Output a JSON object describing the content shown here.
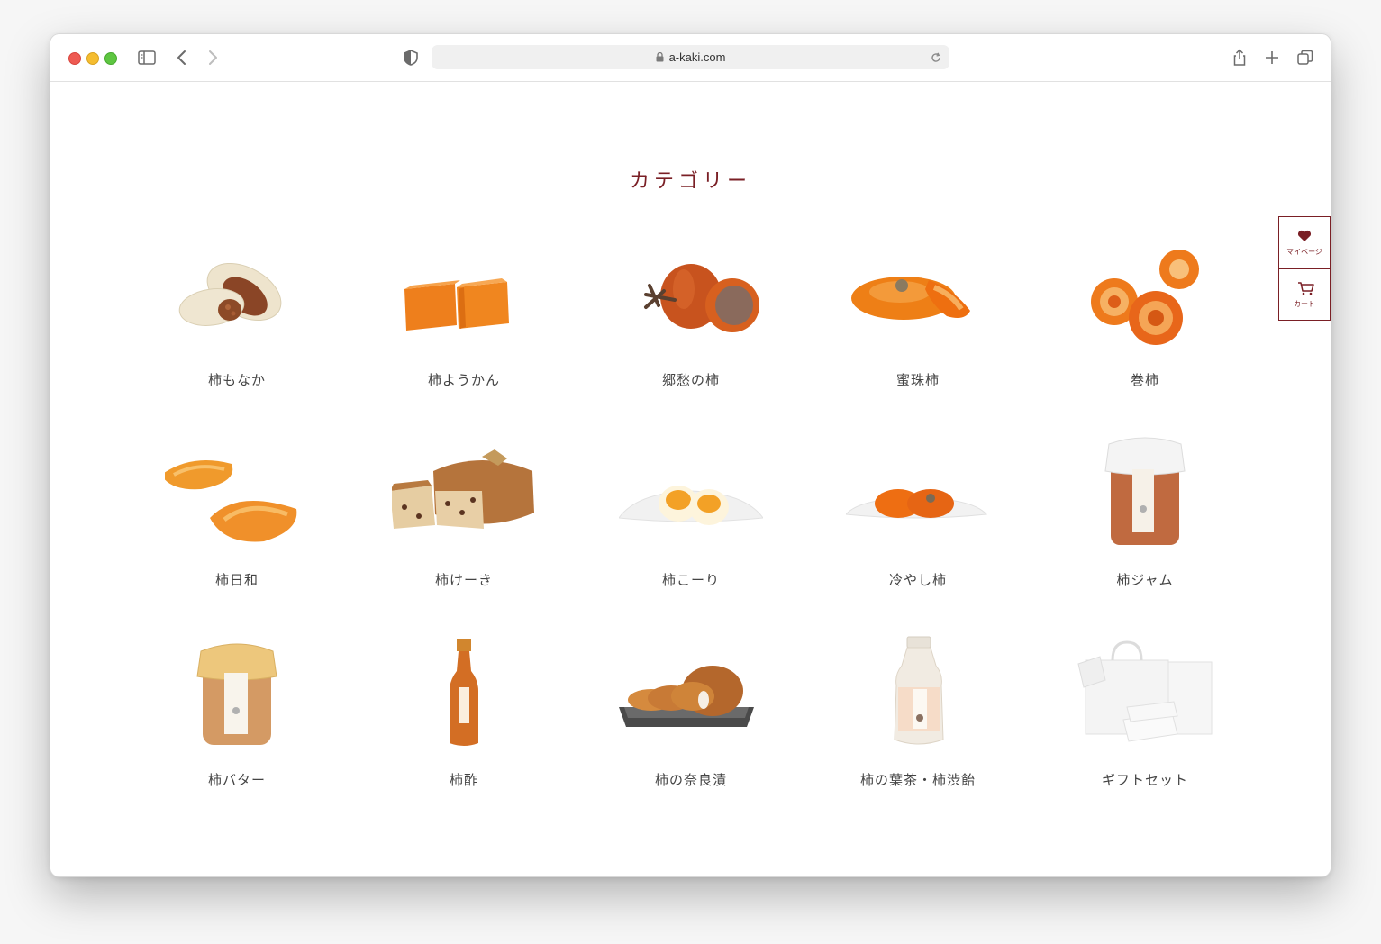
{
  "browser": {
    "url": "a-kaki.com",
    "icons": [
      "sidebar-icon",
      "back-icon",
      "forward-icon",
      "shield-icon",
      "lock-icon",
      "reload-icon",
      "share-icon",
      "new-tab-icon",
      "tabs-icon"
    ]
  },
  "page": {
    "section_title": "カテゴリー",
    "accent_color": "#7a1f25",
    "categories": [
      {
        "label": "柿もなか",
        "icon": "monaka"
      },
      {
        "label": "柿ようかん",
        "icon": "yokan"
      },
      {
        "label": "郷愁の柿",
        "icon": "dried-persimmon"
      },
      {
        "label": "蜜珠柿",
        "icon": "mitsutama"
      },
      {
        "label": "巻柿",
        "icon": "maki-kaki"
      },
      {
        "label": "柿日和",
        "icon": "kaki-biyori"
      },
      {
        "label": "柿けーき",
        "icon": "cake"
      },
      {
        "label": "柿こーり",
        "icon": "ice"
      },
      {
        "label": "冷やし柿",
        "icon": "chilled"
      },
      {
        "label": "柿ジャム",
        "icon": "jam-jar"
      },
      {
        "label": "柿バター",
        "icon": "butter-jar"
      },
      {
        "label": "柿酢",
        "icon": "vinegar-bottle"
      },
      {
        "label": "柿の奈良漬",
        "icon": "narazuke"
      },
      {
        "label": "柿の葉茶・柿渋飴",
        "icon": "tea-bottle"
      },
      {
        "label": "ギフトセット",
        "icon": "gift-bags"
      }
    ]
  },
  "side_nav": {
    "mypage_label": "マイページ",
    "cart_label": "カート"
  }
}
